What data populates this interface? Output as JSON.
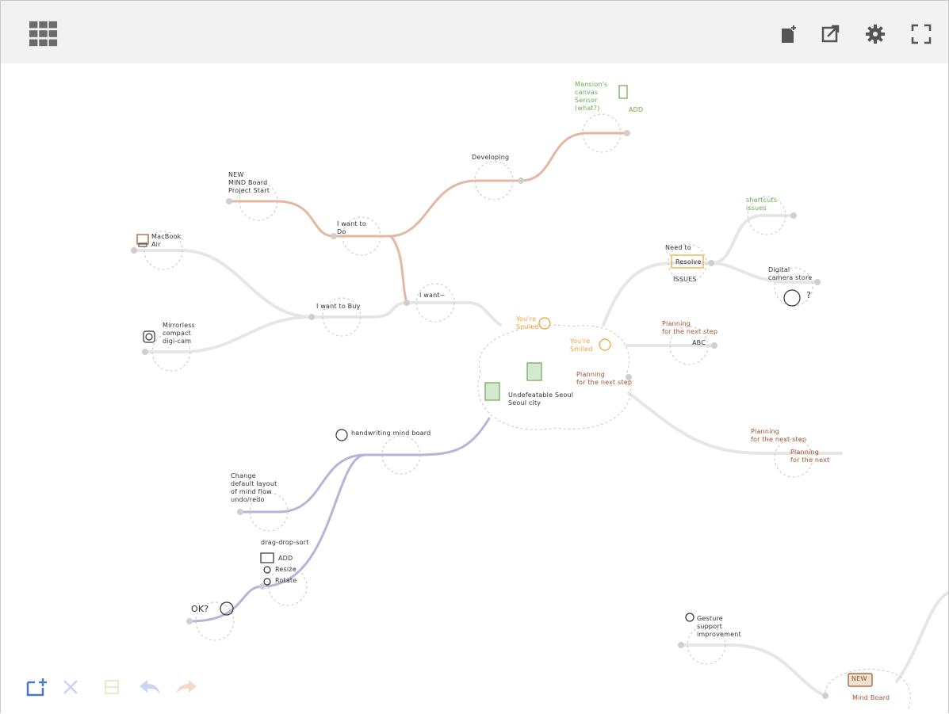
{
  "toolbar": {
    "menu_icon": "grid-menu-icon",
    "actions": [
      {
        "name": "new-document",
        "icon": "new-document-icon"
      },
      {
        "name": "export",
        "icon": "export-icon"
      },
      {
        "name": "settings",
        "icon": "gear-icon"
      },
      {
        "name": "fullscreen",
        "icon": "fullscreen-icon"
      }
    ]
  },
  "mindmap": {
    "center": {
      "caption": "Undefeatable Seoul\nSeoul city"
    },
    "notes": {
      "green_top": "Mansion's\ncanvas\nSensor\n(what?)",
      "green_top_side": "ADD",
      "developing": "Developing",
      "new_mindboard": "NEW\nMIND Board\nProject Start",
      "i_want_to_do": "I want to\nDo",
      "i_want": "I want~",
      "i_want_to_buy": "I want to Buy",
      "macbook": "MacBook\nAir",
      "compact_camera": "Mirrorless\ncompact\ndigi-cam",
      "shortcuts": "shortcuts\nissues",
      "resolve_title": "Need to",
      "resolve_box": "Resolve",
      "issues": "ISSUES",
      "digital_camera": "Digital\ncamera store",
      "question": "?",
      "smile_note_1": "You're\nSmiled",
      "smile_note_2": "You're\nSmiled",
      "planning_1": "Planning\nfor the next step",
      "abc": "ABC",
      "planning_2": "Planning\nfor the next step",
      "planning_3": "Planning\nfor the next step",
      "planning_4": "Planning\nfor the next",
      "emoji_row": "handwriting mind board",
      "change_default": "Change\ndefault layout\nof mind flow\nundo/redo",
      "drag_drop": "drag-drop-sort",
      "add": "ADD",
      "resize": "Resize",
      "rotate": "Rotate",
      "ok": "OK?",
      "gesture": "Gesture\nsupport\nimprovement",
      "new_badge": "NEW",
      "mind_board": "Mind Board"
    }
  },
  "bottom_toolbar": {
    "add_node": "add-node-icon",
    "delete": "close-icon",
    "collapse": "collapse-icon",
    "undo": "undo-icon",
    "redo": "redo-icon"
  },
  "colors": {
    "toolbar_bg": "#f2f2f2",
    "branch_orange": "#e2b8a4",
    "branch_purple": "#b7b4d8",
    "branch_gray": "#e6e6e6",
    "node_dashed": "#c8c8c8",
    "accent_blue": "#4a78c8"
  }
}
